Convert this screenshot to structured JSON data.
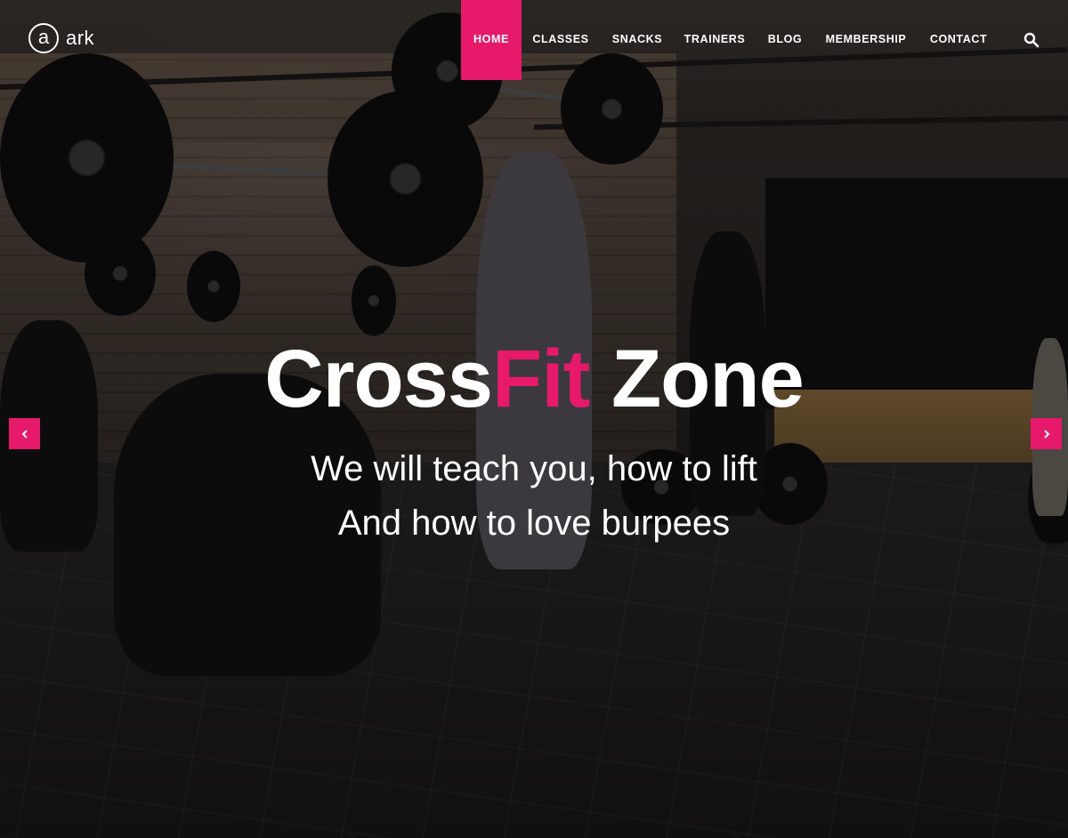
{
  "header": {
    "logo_mark": "a",
    "logo_text": "ark",
    "nav": [
      {
        "label": "HOME",
        "active": true
      },
      {
        "label": "CLASSES",
        "active": false
      },
      {
        "label": "SNACKS",
        "active": false
      },
      {
        "label": "TRAINERS",
        "active": false
      },
      {
        "label": "BLOG",
        "active": false
      },
      {
        "label": "MEMBERSHIP",
        "active": false
      },
      {
        "label": "CONTACT",
        "active": false
      }
    ],
    "search_icon": "search-icon"
  },
  "hero": {
    "title_part1": "Cross",
    "title_accent": "Fit",
    "title_part2": " Zone",
    "line1": "We will teach you, how to lift",
    "line2": "And how to love burpees",
    "prev_icon": "chevron-left-icon",
    "next_icon": "chevron-right-icon"
  },
  "colors": {
    "accent": "#e6196b",
    "text": "#ffffff"
  }
}
